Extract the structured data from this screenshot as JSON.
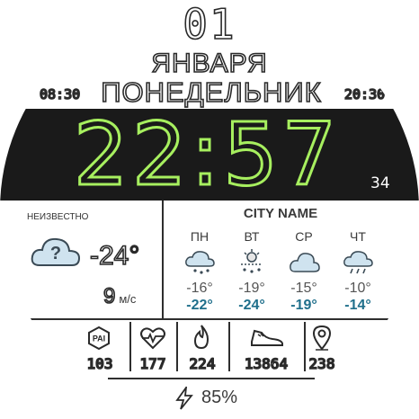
{
  "date": {
    "day": "01",
    "month": "ЯНВАРЯ",
    "weekday": "ПОНЕДЕЛЬНИК"
  },
  "sun": {
    "sunrise": "08:30",
    "sunset": "20:30"
  },
  "time": {
    "hhmm": "22:57",
    "seconds": "34"
  },
  "weather": {
    "condition": "НЕИЗВЕСТНО",
    "current_temp": "-24°",
    "wind_speed": "9",
    "wind_unit": "м/с",
    "city": "CITY NAME",
    "forecast": [
      {
        "day": "ПН",
        "high": "-16°",
        "low": "-22°",
        "icon": "snow-icon"
      },
      {
        "day": "ВТ",
        "high": "-19°",
        "low": "-24°",
        "icon": "snow-night-icon"
      },
      {
        "day": "СР",
        "high": "-15°",
        "low": "-19°",
        "icon": "cloud-icon"
      },
      {
        "day": "ЧТ",
        "high": "-10°",
        "low": "-14°",
        "icon": "rain-cloud-icon"
      }
    ]
  },
  "stats": [
    {
      "name": "pai",
      "icon": "pai-icon",
      "icon_label": "PAI",
      "value": "103"
    },
    {
      "name": "heart-rate",
      "icon": "heart-rate-icon",
      "value": "177"
    },
    {
      "name": "calories",
      "icon": "flame-icon",
      "value": "224"
    },
    {
      "name": "steps",
      "icon": "shoe-icon",
      "value": "13864"
    },
    {
      "name": "distance",
      "icon": "location-pin-icon",
      "value": "238"
    }
  ],
  "battery": {
    "icon": "lightning-icon",
    "value": "85%"
  },
  "colors": {
    "accent": "#a7ef5f",
    "band": "#1a1a1a",
    "forecast_low": "#1f6f8b"
  }
}
